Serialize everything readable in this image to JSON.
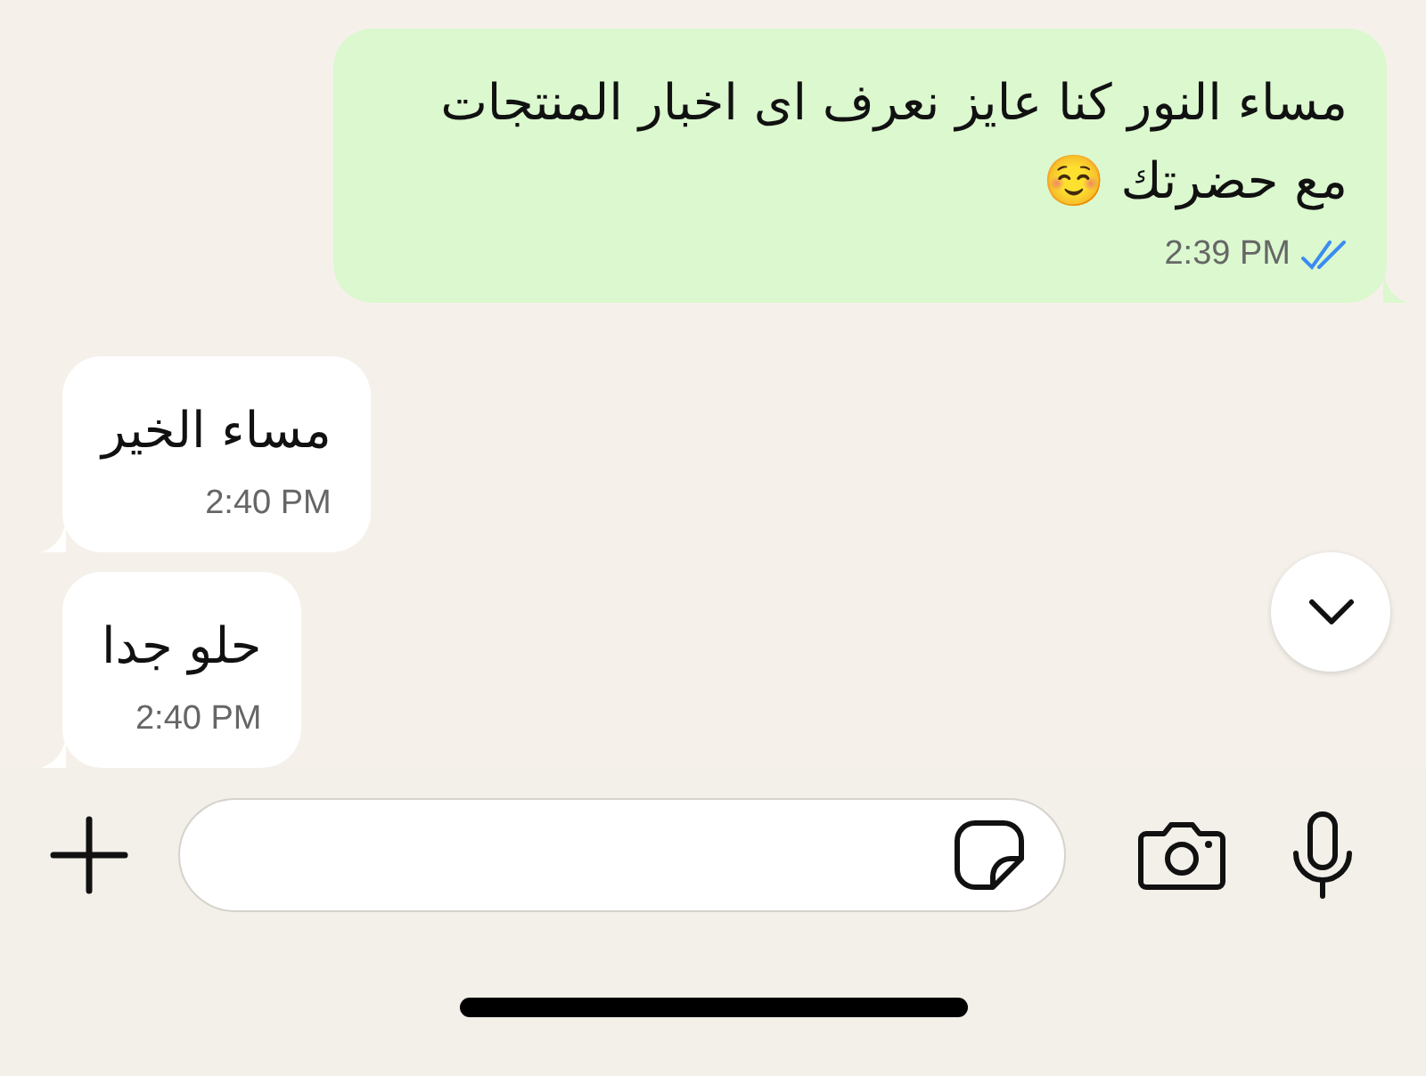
{
  "messages": [
    {
      "kind": "outgoing",
      "text": "مساء النور كنا عايز نعرف اى اخبار المنتجات مع حضرتك ☺️",
      "time": "2:39 PM",
      "read": true
    },
    {
      "kind": "incoming",
      "text": "مساء الخير",
      "time": "2:40 PM"
    },
    {
      "kind": "incoming",
      "text": "حلو جدا",
      "time": "2:40 PM"
    }
  ]
}
